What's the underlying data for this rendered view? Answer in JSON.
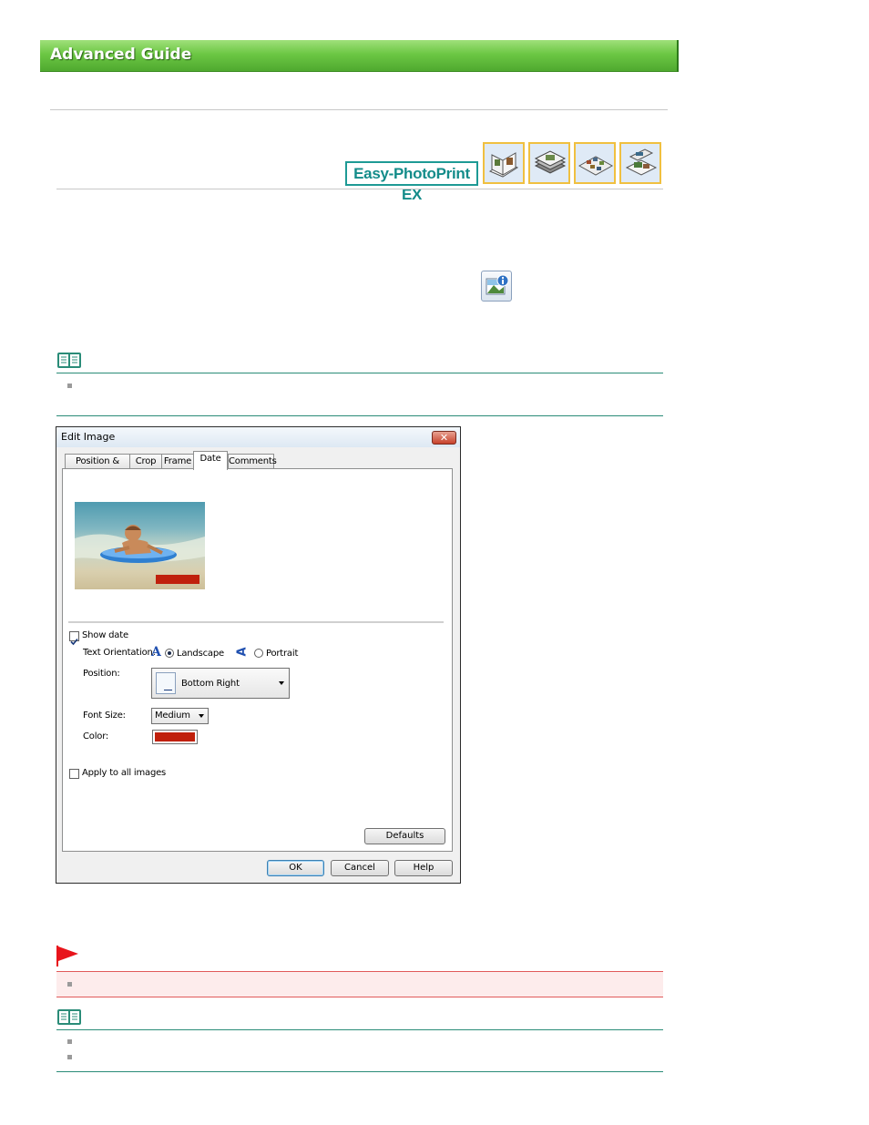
{
  "header": {
    "title": "Advanced Guide"
  },
  "product": {
    "name": "Easy-PhotoPrint EX",
    "mode_icons": [
      "album-icon",
      "calendar-icon",
      "stickers-icon",
      "layout-print-icon"
    ]
  },
  "dialog": {
    "title": "Edit Image",
    "close_glyph": "✕",
    "tabs": [
      "Position & Size",
      "Crop",
      "Frame",
      "Date",
      "Comments"
    ],
    "active_tab": "Date",
    "show_date": {
      "label": "Show date",
      "checked": true
    },
    "text_orientation": {
      "label": "Text Orientation:",
      "options": [
        "Landscape",
        "Portrait"
      ],
      "selected": "Landscape"
    },
    "position": {
      "label": "Position:",
      "value": "Bottom Right"
    },
    "font_size": {
      "label": "Font Size:",
      "value": "Medium"
    },
    "color": {
      "label": "Color:",
      "value": "#c0200c"
    },
    "apply_all": {
      "label": "Apply to all images",
      "checked": false
    },
    "buttons": {
      "defaults": "Defaults",
      "ok": "OK",
      "cancel": "Cancel",
      "help": "Help"
    }
  },
  "colors": {
    "banner_green": "#6cc744",
    "note_line": "#2a8c78",
    "important_flag": "#e8141b",
    "important_bg": "#fdecec",
    "date_bar": "#c0200c"
  }
}
